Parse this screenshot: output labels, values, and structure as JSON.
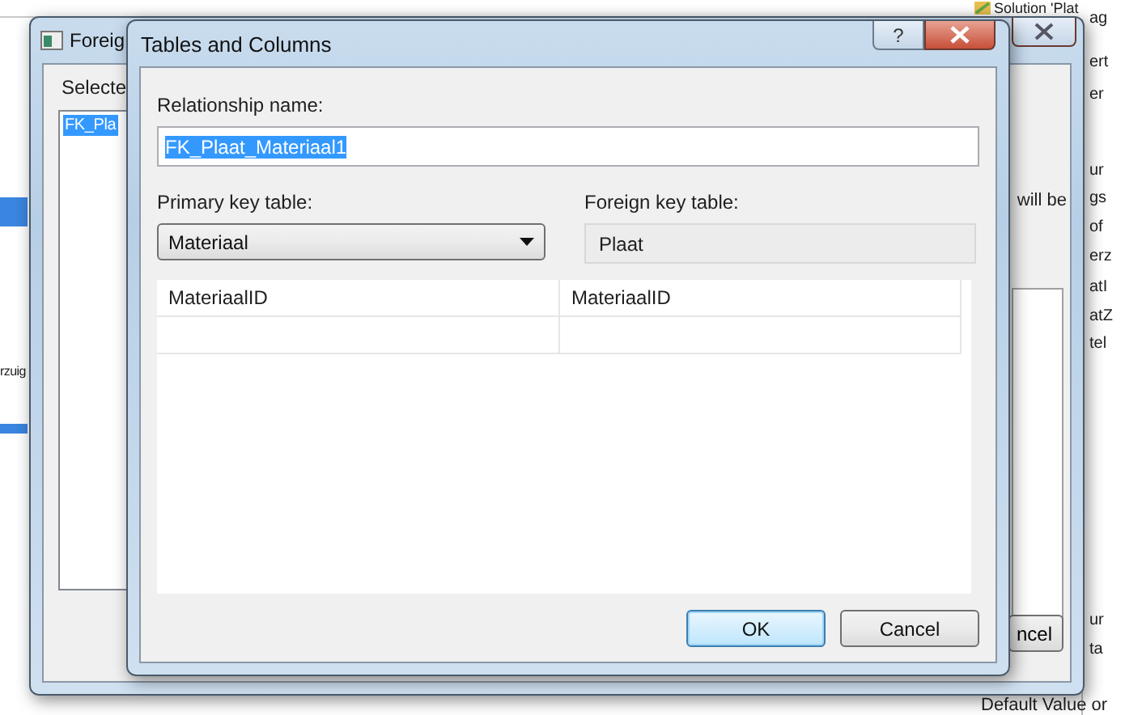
{
  "background": {
    "tree_title": "Solution 'Plat",
    "left_text": "rzuig",
    "right_fragments": [
      "ag",
      "ert",
      "er",
      "ur",
      "gs",
      "of",
      "erz",
      "atI",
      "atZ",
      "tel",
      "ur",
      "ta"
    ],
    "bottom_text": "Default Value or"
  },
  "back_dialog": {
    "title": "Foreig",
    "list_label": "Selecte",
    "items": [
      {
        "label": "FK_Pla",
        "selected": true
      }
    ],
    "note": "will be",
    "button": "ncel"
  },
  "dialog": {
    "title": "Tables and Columns",
    "help": "?",
    "name_label": "Relationship name:",
    "name_value": "FK_Plaat_Materiaal1",
    "name_selected": true,
    "primary_label": "Primary key table:",
    "primary_value": "Materiaal",
    "foreign_label": "Foreign key table:",
    "foreign_value": "Plaat",
    "columns": [
      {
        "primary": "MateriaalID",
        "foreign": "MateriaalID"
      }
    ],
    "buttons": [
      {
        "label": "OK",
        "default": true
      },
      {
        "label": "Cancel",
        "default": false
      }
    ]
  }
}
